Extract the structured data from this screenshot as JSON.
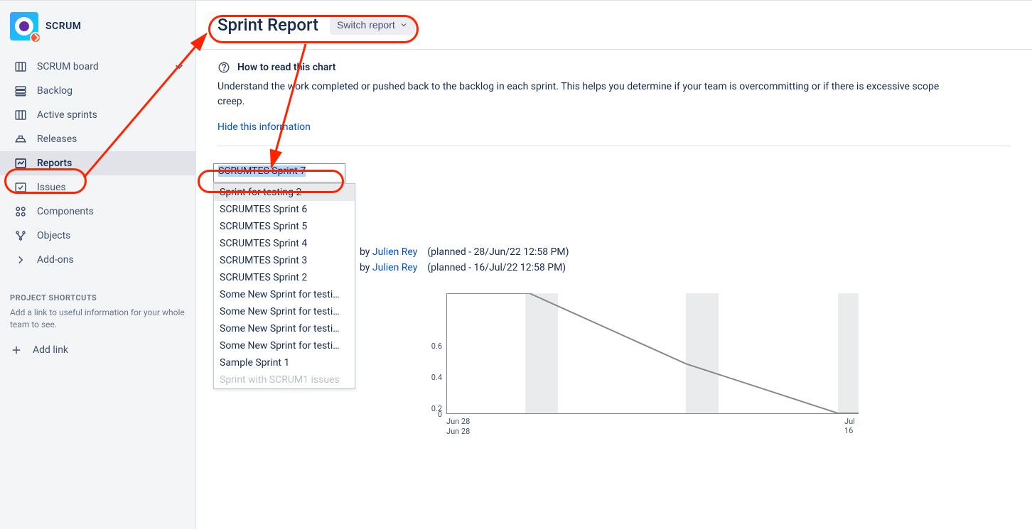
{
  "project": {
    "name": "SCRUM"
  },
  "sidebar": {
    "items": [
      {
        "label": "SCRUM board",
        "icon": "board"
      },
      {
        "label": "Backlog",
        "icon": "backlog"
      },
      {
        "label": "Active sprints",
        "icon": "sprints"
      },
      {
        "label": "Releases",
        "icon": "releases"
      },
      {
        "label": "Reports",
        "icon": "reports"
      },
      {
        "label": "Issues",
        "icon": "issues"
      },
      {
        "label": "Components",
        "icon": "components"
      },
      {
        "label": "Objects",
        "icon": "objects"
      },
      {
        "label": "Add-ons",
        "icon": "addons"
      }
    ],
    "shortcuts_label": "PROJECT SHORTCUTS",
    "shortcuts_desc": "Add a link to useful information for your whole team to see.",
    "add_link_label": "Add link"
  },
  "header": {
    "title": "Sprint Report",
    "switch_label": "Switch report"
  },
  "help": {
    "title": "How to read this chart",
    "description": "Understand the work completed or pushed back to the backlog in each sprint. This helps you determine if your team is overcommitting or if there is excessive scope creep.",
    "hide_label": "Hide this information"
  },
  "sprint_select": {
    "selected": "SCRUMTES Sprint 7",
    "options": [
      "Sprint for testing 2",
      "SCRUMTES Sprint 6",
      "SCRUMTES Sprint 5",
      "SCRUMTES Sprint 4",
      "SCRUMTES Sprint 3",
      "SCRUMTES Sprint 2",
      "Some New Sprint for testi…",
      "Some New Sprint for testi…",
      "Some New Sprint for testi…",
      "Some New Sprint for testi…",
      "Sample Sprint 1",
      "Sprint with SCRUM1 issues"
    ]
  },
  "meta": {
    "rows": [
      {
        "by": "by",
        "user": "Julien Rey",
        "planned": "(planned - 28/Jun/22 12:58 PM)"
      },
      {
        "by": "by",
        "user": "Julien Rey",
        "planned": "(planned - 16/Jul/22 12:58 PM)"
      }
    ]
  },
  "chart_data": {
    "type": "line",
    "y_ticks": [
      "0",
      "0.2",
      "0.4",
      "0.6"
    ],
    "x_ticks": [
      "Jun 28",
      "Jun 28",
      "Jul 16"
    ],
    "x": [
      0,
      0.2,
      0.58,
      0.58,
      0.95,
      0.95
    ],
    "values": [
      1.0,
      1.0,
      0.4,
      0.4,
      0.0,
      0.0
    ],
    "ylim": [
      0,
      1.0
    ]
  }
}
